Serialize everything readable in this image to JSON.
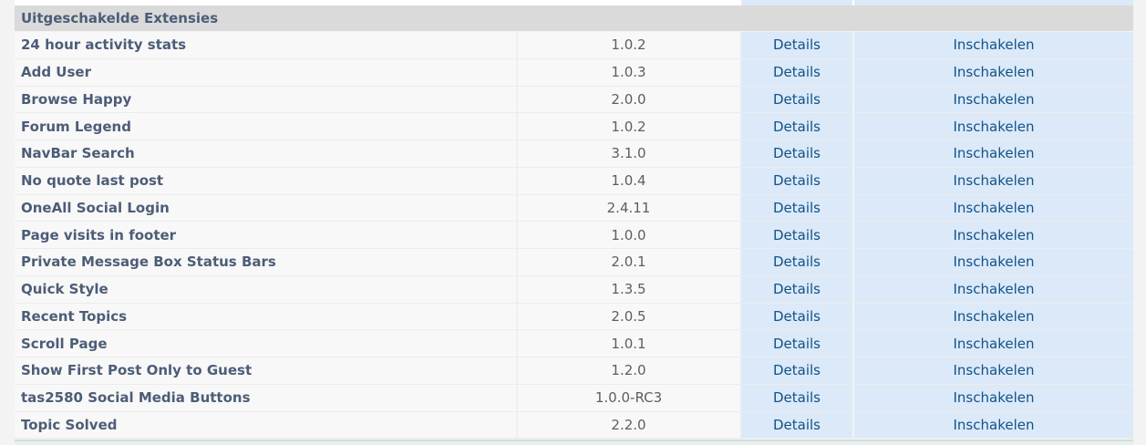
{
  "section": {
    "title": "Uitgeschakelde Extensies"
  },
  "extensions": [
    {
      "name": "24 hour activity stats",
      "version": "1.0.2",
      "details": "Details",
      "action": "Inschakelen"
    },
    {
      "name": "Add User",
      "version": "1.0.3",
      "details": "Details",
      "action": "Inschakelen"
    },
    {
      "name": "Browse Happy",
      "version": "2.0.0",
      "details": "Details",
      "action": "Inschakelen"
    },
    {
      "name": "Forum Legend",
      "version": "1.0.2",
      "details": "Details",
      "action": "Inschakelen"
    },
    {
      "name": "NavBar Search",
      "version": "3.1.0",
      "details": "Details",
      "action": "Inschakelen"
    },
    {
      "name": "No quote last post",
      "version": "1.0.4",
      "details": "Details",
      "action": "Inschakelen"
    },
    {
      "name": "OneAll Social Login",
      "version": "2.4.11",
      "details": "Details",
      "action": "Inschakelen"
    },
    {
      "name": "Page visits in footer",
      "version": "1.0.0",
      "details": "Details",
      "action": "Inschakelen"
    },
    {
      "name": "Private Message Box Status Bars",
      "version": "2.0.1",
      "details": "Details",
      "action": "Inschakelen"
    },
    {
      "name": "Quick Style",
      "version": "1.3.5",
      "details": "Details",
      "action": "Inschakelen"
    },
    {
      "name": "Recent Topics",
      "version": "2.0.5",
      "details": "Details",
      "action": "Inschakelen"
    },
    {
      "name": "Scroll Page",
      "version": "1.0.1",
      "details": "Details",
      "action": "Inschakelen"
    },
    {
      "name": "Show First Post Only to Guest",
      "version": "1.2.0",
      "details": "Details",
      "action": "Inschakelen"
    },
    {
      "name": "tas2580 Social Media Buttons",
      "version": "1.0.0-RC3",
      "details": "Details",
      "action": "Inschakelen"
    },
    {
      "name": "Topic Solved",
      "version": "2.2.0",
      "details": "Details",
      "action": "Inschakelen"
    }
  ],
  "colors": {
    "header_bg": "#dadada",
    "name_text": "#4c5d77",
    "link_text": "#105289",
    "action_bg": "#dce9f8",
    "row_bg": "#f8f8f8"
  }
}
